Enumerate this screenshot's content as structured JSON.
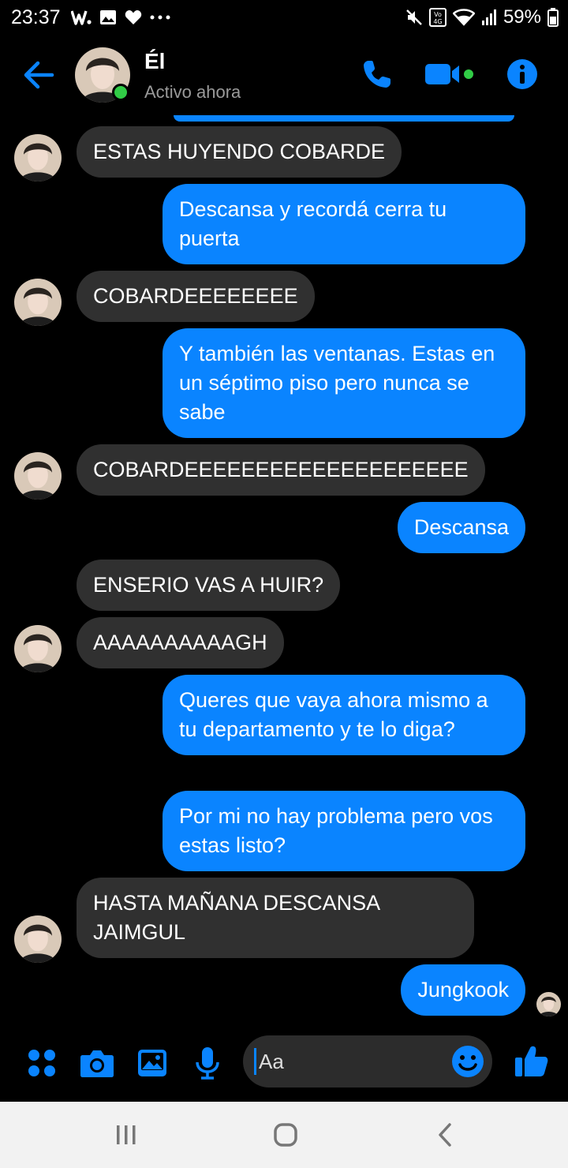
{
  "status_bar": {
    "time": "23:37",
    "notification_icons": [
      "w-app-icon",
      "gallery-icon",
      "heart-icon",
      "more-dots-icon"
    ],
    "right_icons": [
      "mute-icon",
      "volte-4g-icon",
      "wifi-icon",
      "signal-icon"
    ],
    "battery": "59%"
  },
  "header": {
    "name": "Él",
    "status": "Activo ahora",
    "online": true,
    "actions": [
      "phone-icon",
      "video-icon",
      "info-icon"
    ]
  },
  "messages": [
    {
      "side": "in",
      "text": "ESTAS HUYENDO COBARDE",
      "show_avatar": true
    },
    {
      "side": "out",
      "text": "Descansa y recordá cerra tu puerta"
    },
    {
      "side": "in",
      "text": "COBARDEEEEEEEE",
      "show_avatar": true
    },
    {
      "side": "out",
      "text": "Y también las ventanas. Estas en un séptimo piso pero nunca se sabe"
    },
    {
      "side": "in",
      "text": "COBARDEEEEEEEEEEEEEEEEEEEE",
      "show_avatar": true
    },
    {
      "side": "out",
      "text": "Descansa"
    },
    {
      "side": "in",
      "text": "ENSERIO VAS A HUIR?",
      "show_avatar": false
    },
    {
      "side": "in",
      "text": "AAAAAAAAAAGH",
      "show_avatar": true
    },
    {
      "side": "out",
      "text": "Queres que vaya ahora mismo a tu departamento y te lo diga?"
    },
    {
      "side": "out",
      "text": "Por mi no hay problema pero vos estas listo?"
    },
    {
      "side": "in",
      "text": "HASTA MAÑANA DESCANSA JAIMGUL",
      "show_avatar": true
    },
    {
      "side": "out",
      "text": "Jungkook",
      "seen": true
    }
  ],
  "composer": {
    "placeholder": "Aa",
    "buttons": [
      "menu-dots-icon",
      "camera-icon",
      "image-icon",
      "microphone-icon",
      "emoji-icon",
      "like-icon"
    ]
  },
  "colors": {
    "accent": "#0a84ff",
    "incoming_bubble": "#303030",
    "background": "#000000",
    "online": "#31cc46"
  }
}
